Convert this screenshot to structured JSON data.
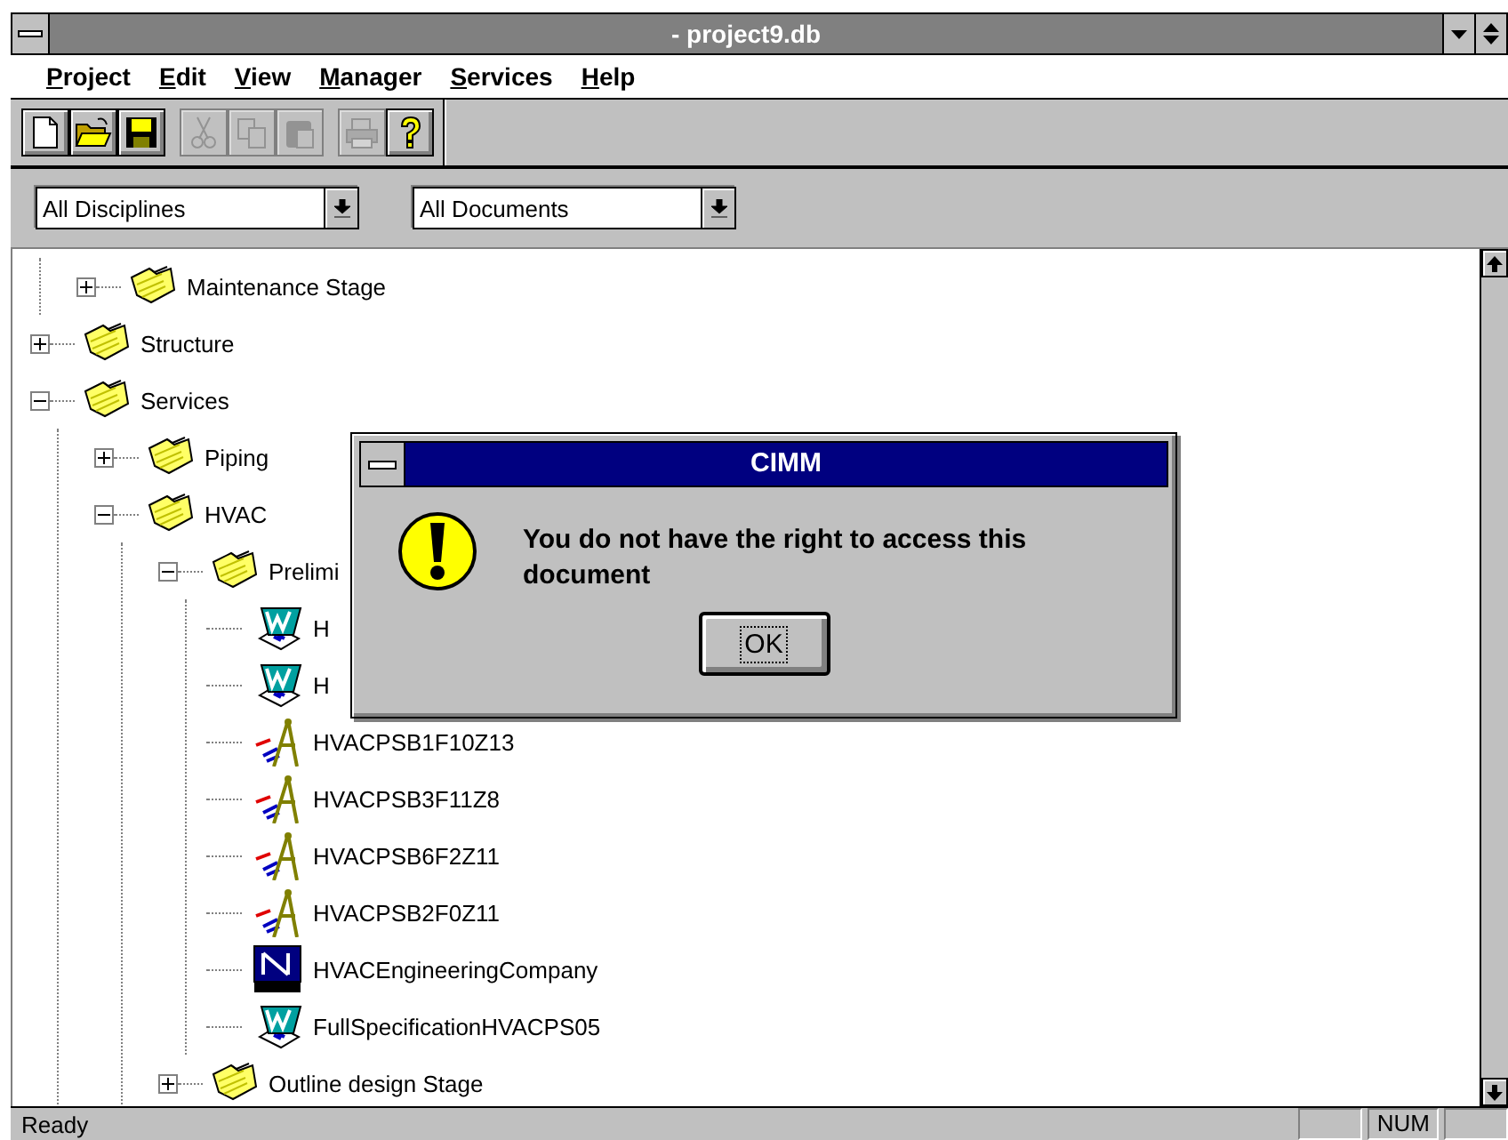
{
  "window": {
    "title": "- project9.db"
  },
  "menu": [
    "Project",
    "Edit",
    "View",
    "Manager",
    "Services",
    "Help"
  ],
  "toolbar": [
    {
      "kind": "new",
      "disabled": false
    },
    {
      "kind": "open",
      "disabled": false
    },
    {
      "kind": "save",
      "disabled": false
    },
    {
      "kind": "sep"
    },
    {
      "kind": "cut",
      "disabled": true
    },
    {
      "kind": "copy",
      "disabled": true
    },
    {
      "kind": "paste",
      "disabled": true
    },
    {
      "kind": "sep"
    },
    {
      "kind": "print",
      "disabled": true
    },
    {
      "kind": "help",
      "disabled": false
    }
  ],
  "filters": [
    {
      "value": "All Disciplines"
    },
    {
      "value": "All Documents"
    }
  ],
  "tree": {
    "items": [
      {
        "children": [
          {
            "label": "Maintenance Stage",
            "kind": "folder",
            "expanded": false
          }
        ]
      },
      {
        "label": "Structure",
        "kind": "folder",
        "expanded": false
      },
      {
        "label": "Services",
        "kind": "folder",
        "expanded": true,
        "children": [
          {
            "label": "Piping",
            "kind": "folder",
            "expanded": false
          },
          {
            "label": "HVAC",
            "kind": "folder",
            "expanded": true,
            "children": [
              {
                "label": "Prelimi",
                "kind": "folder",
                "expanded": true,
                "children": [
                  {
                    "label": "H",
                    "kind": "document"
                  },
                  {
                    "label": "H",
                    "kind": "document"
                  },
                  {
                    "label": "HVACPSB1F10Z13",
                    "kind": "drawing"
                  },
                  {
                    "label": "HVACPSB3F11Z8",
                    "kind": "drawing"
                  },
                  {
                    "label": "HVACPSB6F2Z11",
                    "kind": "drawing"
                  },
                  {
                    "label": "HVACPSB2F0Z11",
                    "kind": "drawing"
                  },
                  {
                    "label": "HVACEngineeringCompany",
                    "kind": "web"
                  },
                  {
                    "label": "FullSpecificationHVACPS05",
                    "kind": "document"
                  }
                ]
              },
              {
                "label": "Outline design Stage",
                "kind": "folder",
                "expanded": false
              }
            ]
          }
        ]
      }
    ]
  },
  "dialog": {
    "title": "CIMM",
    "message": "You do not have the right to access this document",
    "buttons": [
      {
        "label": "OK",
        "focused": true
      }
    ]
  },
  "status_bar": {
    "text": "Ready",
    "panels": [
      {
        "kind": "blank"
      },
      {
        "kind": "text",
        "text": "NUM"
      },
      {
        "kind": "blank"
      }
    ]
  }
}
